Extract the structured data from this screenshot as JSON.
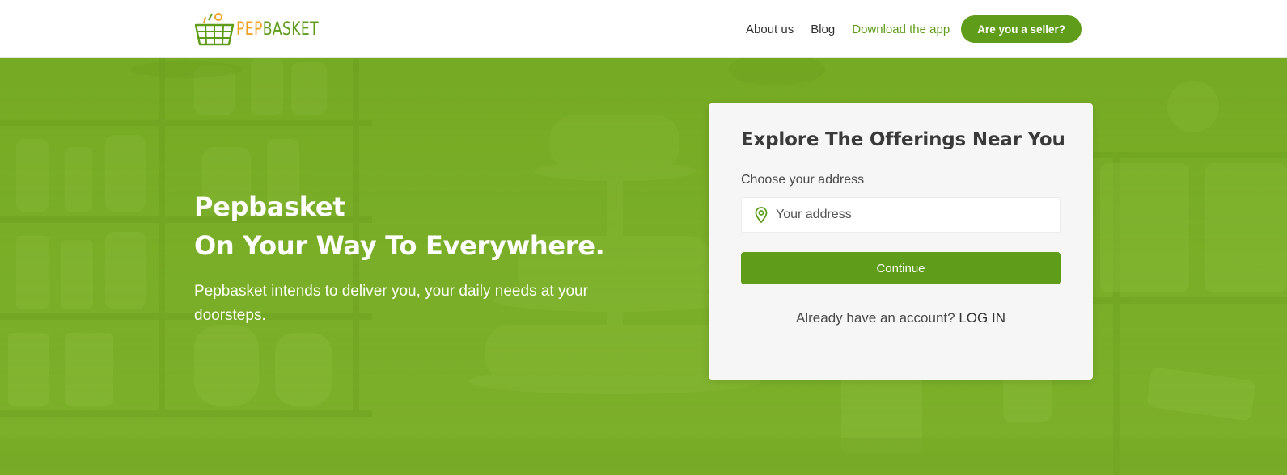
{
  "brand": {
    "logo_part1": "PEP",
    "logo_part2": "BASKET"
  },
  "nav": {
    "about": "About us",
    "blog": "Blog",
    "download": "Download the app",
    "seller": "Are you a seller?"
  },
  "hero": {
    "title_line1": "Pepbasket",
    "title_line2": "On Your Way To Everywhere.",
    "description": "Pepbasket intends to deliver you, your daily needs at your doorsteps."
  },
  "card": {
    "title": "Explore The Offerings Near You",
    "address_label": "Choose your address",
    "address_placeholder": "Your address",
    "address_value": "",
    "continue_label": "Continue",
    "account_prompt": "Already have an account?",
    "login_label": "LOG IN"
  },
  "icons": {
    "logo": "basket-icon",
    "address": "map-pin-icon"
  },
  "colors": {
    "brand_green": "#5e9c19",
    "brand_orange": "#f2a121",
    "hero_bg": "#79ad26",
    "card_bg": "#f6f6f6"
  }
}
